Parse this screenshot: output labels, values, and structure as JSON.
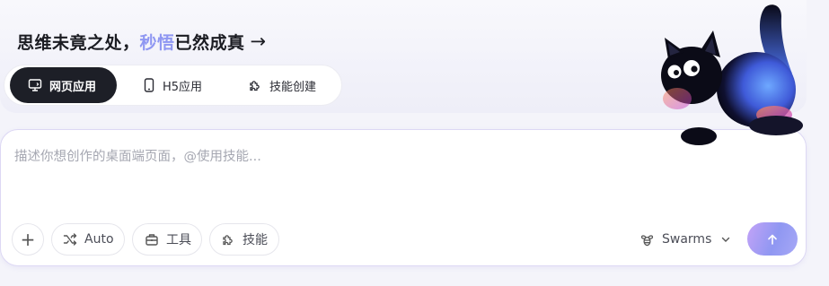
{
  "headline": {
    "prefix": "思维未竟之处，",
    "accent": "秒悟",
    "suffix": "已然成真",
    "arrow": "→"
  },
  "tabs": [
    {
      "label": "网页应用",
      "icon": "monitor-icon",
      "active": true
    },
    {
      "label": "H5应用",
      "icon": "phone-icon",
      "active": false
    },
    {
      "label": "技能创建",
      "icon": "puzzle-icon",
      "active": false
    }
  ],
  "composer": {
    "placeholder": "描述你想创作的桌面端页面，@使用技能...",
    "value": ""
  },
  "toolbar": {
    "add_label": "+",
    "auto_label": "Auto",
    "tools_label": "工具",
    "skills_label": "技能"
  },
  "model_selector": {
    "label": "Swarms",
    "icon": "bee-icon"
  },
  "send_button": {
    "icon": "arrow-up-icon"
  },
  "mascot": {
    "icon": "black-cat-mascot"
  },
  "colors": {
    "accent": "#8f97f2",
    "active_tab_bg": "#1d1f27",
    "send_gradient_start": "#c3a3f7",
    "send_gradient_end": "#8f97f2"
  }
}
